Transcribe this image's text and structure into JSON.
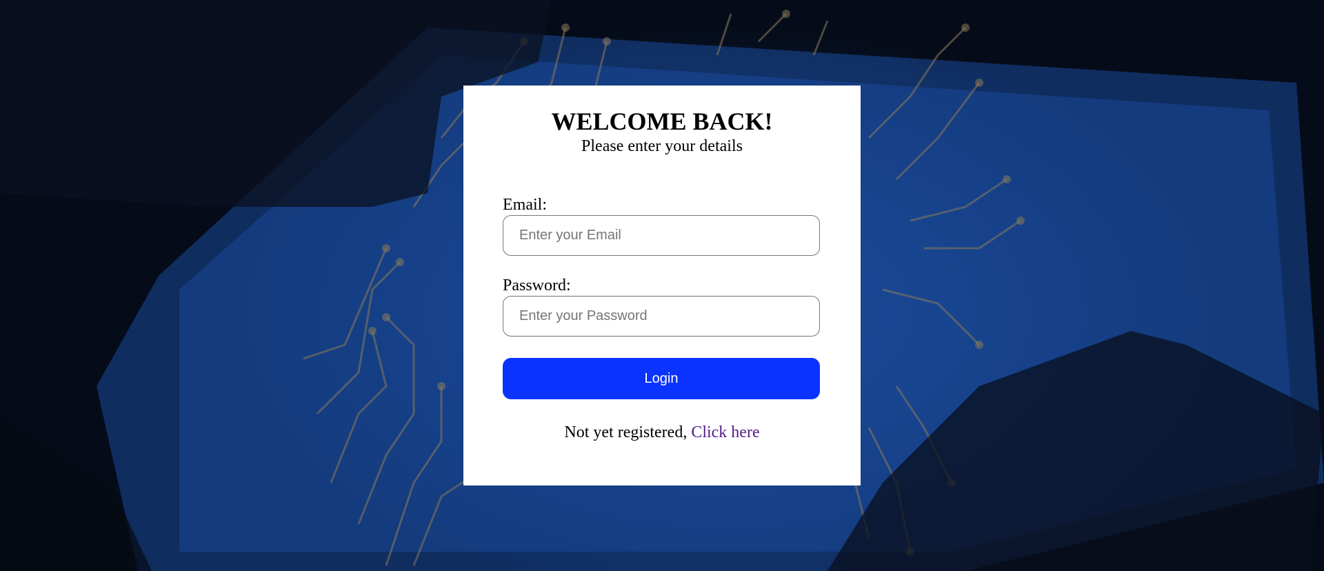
{
  "login_card": {
    "title": "WELCOME BACK!",
    "subtitle": "Please enter your details",
    "email": {
      "label": "Email:",
      "placeholder": "Enter your Email",
      "value": ""
    },
    "password": {
      "label": "Password:",
      "placeholder": "Enter your Password",
      "value": ""
    },
    "login_button_label": "Login",
    "register_prompt": "Not yet registered,",
    "register_link": "Click here"
  },
  "colors": {
    "primary_button": "#0a33ff",
    "link": "#551a8b",
    "card_background": "#ffffff"
  }
}
